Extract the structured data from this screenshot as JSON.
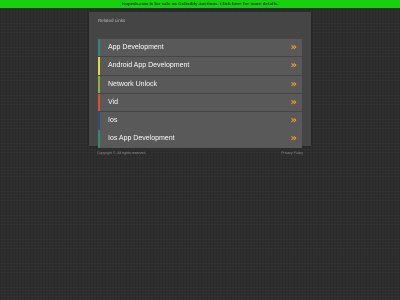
{
  "banner": {
    "text": "isupesh.com is for sale on GoDaddy Auctions. Click here for more details.",
    "background_color": "#16d10c"
  },
  "panel": {
    "title": "Related Links",
    "links": [
      {
        "label": "App Development",
        "arrow": "»",
        "accent_color": "#2e8b7a"
      },
      {
        "label": "Android App Development",
        "arrow": "»",
        "accent_color": "#e6d64a"
      },
      {
        "label": "Network Unlock",
        "arrow": "»",
        "accent_color": "#8bb43a"
      },
      {
        "label": "Vid",
        "arrow": "»",
        "accent_color": "#d4572a"
      },
      {
        "label": "Ios",
        "arrow": "»",
        "accent_color": "#2e4f7a"
      },
      {
        "label": "Ios App Development",
        "arrow": "»",
        "accent_color": "#2e8b7a"
      }
    ],
    "arrow_color": "#f2a01d"
  },
  "footer": {
    "copyright": "Copyright ©. All rights reserved.",
    "privacy_link": "Privacy Policy"
  }
}
